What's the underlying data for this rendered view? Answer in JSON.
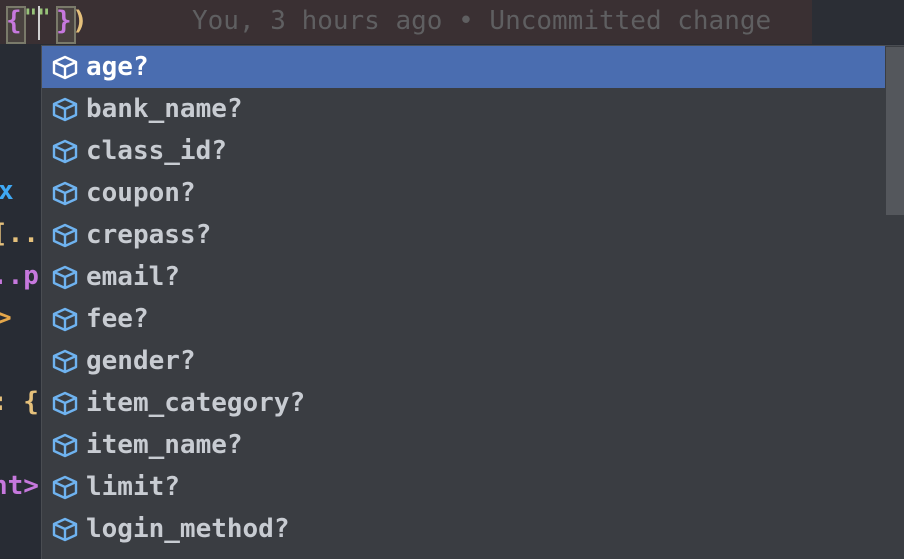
{
  "editor": {
    "blame_text": "You, 3 hours ago • Uncommitted change",
    "current_line": {
      "open_brace": "{",
      "quotes": "\"\"",
      "close_brace": "}",
      "close_paren": ")"
    },
    "left_fragments": [
      {
        "text": "x",
        "color": "#3fa9f5"
      },
      {
        "text": "[..",
        "color": "#e5c07b"
      },
      {
        "text": "..p",
        "color": "#c678dd"
      },
      {
        "text": ">",
        "color": "#e5a74a"
      },
      {
        "text": ": {",
        "color": "#e5c07b"
      },
      {
        "text": "nt>",
        "color": "#c678dd"
      }
    ]
  },
  "completion": {
    "items": [
      {
        "label": "age?",
        "icon": "property-cube-icon",
        "selected": true
      },
      {
        "label": "bank_name?",
        "icon": "property-cube-icon"
      },
      {
        "label": "class_id?",
        "icon": "property-cube-icon"
      },
      {
        "label": "coupon?",
        "icon": "property-cube-icon"
      },
      {
        "label": "crepass?",
        "icon": "property-cube-icon"
      },
      {
        "label": "email?",
        "icon": "property-cube-icon"
      },
      {
        "label": "fee?",
        "icon": "property-cube-icon"
      },
      {
        "label": "gender?",
        "icon": "property-cube-icon"
      },
      {
        "label": "item_category?",
        "icon": "property-cube-icon"
      },
      {
        "label": "item_name?",
        "icon": "property-cube-icon"
      },
      {
        "label": "limit?",
        "icon": "property-cube-icon"
      },
      {
        "label": "login_method?",
        "icon": "property-cube-icon"
      }
    ]
  },
  "colors": {
    "selection": "#4a6db0",
    "icon_stroke": "#6fb3f0",
    "popup_bg": "#3a3d42"
  }
}
